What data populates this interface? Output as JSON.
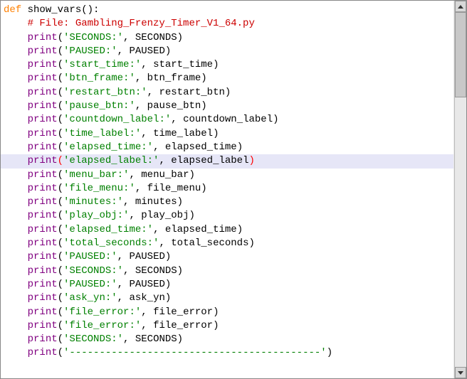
{
  "code": {
    "def_kw": "def",
    "func_name": " show_vars():",
    "comment": "    # File: Gambling_Frenzy_Timer_V1_64.py",
    "print": "print",
    "lines": [
      {
        "str": "'SECONDS:'",
        "var": "SECONDS"
      },
      {
        "str": "'PAUSED:'",
        "var": "PAUSED"
      },
      {
        "str": "'start_time:'",
        "var": "start_time"
      },
      {
        "str": "'btn_frame:'",
        "var": "btn_frame"
      },
      {
        "str": "'restart_btn:'",
        "var": "restart_btn"
      },
      {
        "str": "'pause_btn:'",
        "var": "pause_btn"
      },
      {
        "str": "'countdown_label:'",
        "var": "countdown_label"
      },
      {
        "str": "'time_label:'",
        "var": "time_label"
      },
      {
        "str": "'elapsed_time:'",
        "var": "elapsed_time"
      },
      {
        "str": "'elapsed_label:'",
        "var": "elapsed_label",
        "highlight": true
      },
      {
        "str": "'menu_bar:'",
        "var": "menu_bar"
      },
      {
        "str": "'file_menu:'",
        "var": "file_menu"
      },
      {
        "str": "'minutes:'",
        "var": "minutes"
      },
      {
        "str": "'play_obj:'",
        "var": "play_obj"
      },
      {
        "str": "'elapsed_time:'",
        "var": "elapsed_time"
      },
      {
        "str": "'total_seconds:'",
        "var": "total_seconds"
      },
      {
        "str": "'PAUSED:'",
        "var": "PAUSED"
      },
      {
        "str": "'SECONDS:'",
        "var": "SECONDS"
      },
      {
        "str": "'PAUSED:'",
        "var": "PAUSED"
      },
      {
        "str": "'ask_yn:'",
        "var": "ask_yn"
      },
      {
        "str": "'file_error:'",
        "var": "file_error"
      },
      {
        "str": "'file_error:'",
        "var": "file_error"
      },
      {
        "str": "'SECONDS:'",
        "var": "SECONDS"
      }
    ],
    "dashes": "'------------------------------------------'",
    "indent": "    "
  }
}
